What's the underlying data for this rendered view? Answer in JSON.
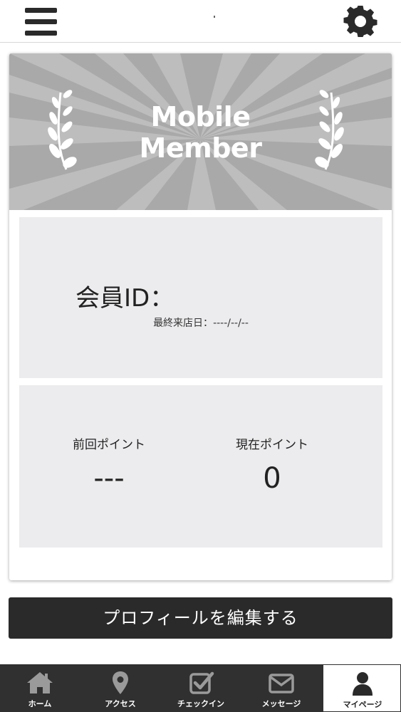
{
  "header": {
    "menu_icon": "hamburger-menu-icon",
    "settings_icon": "gear-icon"
  },
  "card": {
    "banner_title_line1": "Mobile",
    "banner_title_line2": "Member",
    "member_id_label": "会員ID：",
    "last_visit_label": "最終来店日：",
    "last_visit_value": "----/--/--",
    "previous_points_label": "前回ポイント",
    "previous_points_value": "---",
    "current_points_label": "現在ポイント",
    "current_points_value": "0"
  },
  "edit_profile_button": "プロフィールを編集する",
  "tabs": [
    {
      "label": "ホーム",
      "icon": "home-icon",
      "active": false
    },
    {
      "label": "アクセス",
      "icon": "map-pin-icon",
      "active": false
    },
    {
      "label": "チェックイン",
      "icon": "checkbox-icon",
      "active": false
    },
    {
      "label": "メッセージ",
      "icon": "envelope-icon",
      "active": false
    },
    {
      "label": "マイページ",
      "icon": "user-icon",
      "active": true
    }
  ],
  "colors": {
    "banner_bg": "#a9a9a9",
    "panel_bg": "#ececee",
    "dark": "#2a2a2a",
    "tabbar_bg": "#303030"
  }
}
